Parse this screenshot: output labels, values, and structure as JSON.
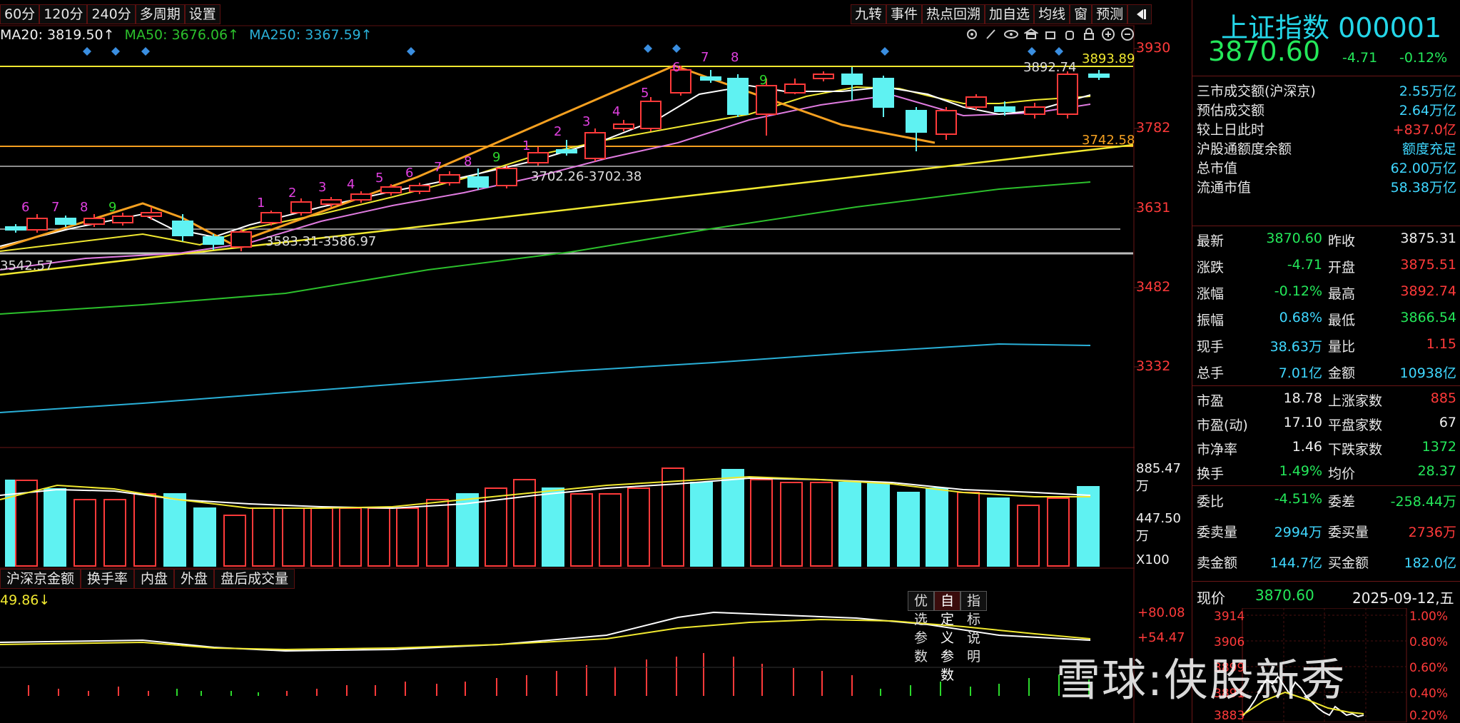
{
  "toolbar_left": [
    "60分",
    "120分",
    "240分",
    "多周期",
    "设置"
  ],
  "toolbar_right": [
    "九转",
    "事件",
    "热点回溯",
    "加自选",
    "均线",
    "窗",
    "预测"
  ],
  "ma_legend": {
    "ma20": "MA20: 3819.50↑",
    "ma50": "MA50: 3676.06↑",
    "ma250": "MA250: 3367.59↑"
  },
  "price_axis": [
    "3930",
    "3782",
    "3631",
    "3482",
    "3332"
  ],
  "volume_axis": [
    "885.47万",
    "447.50万",
    "X100"
  ],
  "indicator_axis": [
    "+80.08",
    "+54.47"
  ],
  "annotations": {
    "high_label": "3892.74",
    "top_line": "3893.89",
    "mid_line": "3742.58",
    "range1": "3702.26-3702.38",
    "range2": "3583.31-3586.97",
    "left_val": "3542.57"
  },
  "seq_labels_left": [
    "6",
    "7",
    "8",
    "9"
  ],
  "seq_labels_up": [
    "1",
    "2",
    "3",
    "4",
    "5",
    "6",
    "7",
    "8",
    "9"
  ],
  "seq_labels_up2": [
    "1",
    "2",
    "3",
    "4",
    "5",
    "6",
    "7",
    "8"
  ],
  "seq_right": "9",
  "indicator_tabs": [
    "沪深京金额",
    "换手率",
    "内盘",
    "外盘",
    "盘后成交量"
  ],
  "indicator_value": "49.86↓",
  "indicator_buttons": [
    "优选参数",
    "自定义参数",
    "指标说明"
  ],
  "panel": {
    "title": "上证指数 000001",
    "price": "3870.60",
    "change": "-4.71",
    "change_pct": "-0.12%",
    "stats1": [
      {
        "label": "三市成交额(沪深京)",
        "value": "2.55万亿"
      },
      {
        "label": "预估成交额",
        "value": "2.64万亿"
      },
      {
        "label": "较上日此时",
        "value": "+837.0亿"
      },
      {
        "label": "沪股通额度余额",
        "value": "额度充足"
      },
      {
        "label": "总市值",
        "value": "62.00万亿"
      },
      {
        "label": "流通市值",
        "value": "58.38万亿"
      }
    ],
    "quote": [
      {
        "l1": "最新",
        "v1": "3870.60",
        "l2": "昨收",
        "v2": "3875.31"
      },
      {
        "l1": "涨跌",
        "v1": "-4.71",
        "l2": "开盘",
        "v2": "3875.51"
      },
      {
        "l1": "涨幅",
        "v1": "-0.12%",
        "l2": "最高",
        "v2": "3892.74"
      },
      {
        "l1": "振幅",
        "v1": "0.68%",
        "l2": "最低",
        "v2": "3866.54"
      },
      {
        "l1": "现手",
        "v1": "38.63万",
        "l2": "量比",
        "v2": "1.15"
      },
      {
        "l1": "总手",
        "v1": "7.01亿",
        "l2": "金额",
        "v2": "10938亿"
      }
    ],
    "valuation": [
      {
        "l1": "市盈",
        "v1": "18.78",
        "l2": "上涨家数",
        "v2": "885"
      },
      {
        "l1": "市盈(动)",
        "v1": "17.10",
        "l2": "平盘家数",
        "v2": "67"
      },
      {
        "l1": "市净率",
        "v1": "1.46",
        "l2": "下跌家数",
        "v2": "1372"
      },
      {
        "l1": "换手",
        "v1": "1.49%",
        "l2": "均价",
        "v2": "28.37"
      }
    ],
    "orders": [
      {
        "l1": "委比",
        "v1": "-4.51%",
        "l2": "委差",
        "v2": "-258.44万"
      },
      {
        "l1": "委卖量",
        "v1": "2994万",
        "l2": "委买量",
        "v2": "2736万"
      },
      {
        "l1": "卖金额",
        "v1": "144.7亿",
        "l2": "买金额",
        "v2": "182.0亿"
      }
    ],
    "current_label": "现价",
    "current_value": "3870.60",
    "date": "2025-09-12,五",
    "mini_left": [
      "3914",
      "3906",
      "3899",
      "3891",
      "3883"
    ],
    "mini_right": [
      "1.00%",
      "0.80%",
      "0.60%",
      "0.40%",
      "0.20%"
    ]
  },
  "watermark": "雪球:侠股新秀",
  "colors": {
    "up": "#ff3a3a",
    "down": "#5ff2f2",
    "ma_white": "#ffffff",
    "ma_yellow": "#f0e830",
    "ma_pink": "#e07be0",
    "ma_green": "#2cc02c",
    "ma_cyan": "#2ab0d8"
  }
}
